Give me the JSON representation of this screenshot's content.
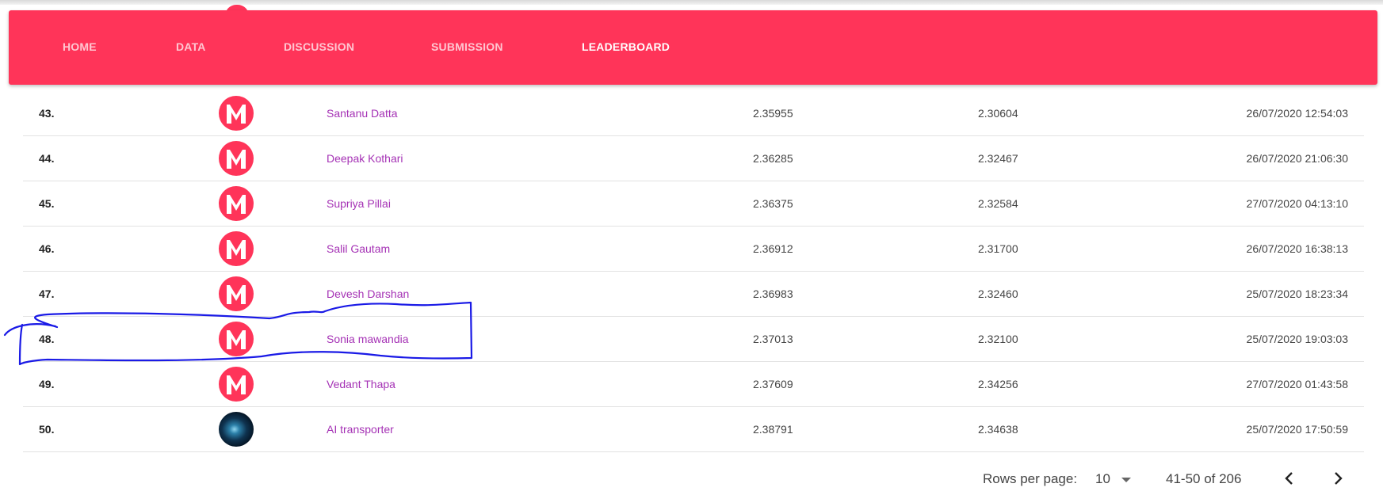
{
  "nav": {
    "items": [
      {
        "label": "HOME",
        "active": false
      },
      {
        "label": "DATA",
        "active": false
      },
      {
        "label": "DISCUSSION",
        "active": false
      },
      {
        "label": "SUBMISSION",
        "active": false
      },
      {
        "label": "LEADERBOARD",
        "active": true
      }
    ],
    "color": "#ff3459"
  },
  "leaderboard": {
    "rows": [
      {
        "rank": "43.",
        "avatar": "m-logo-icon",
        "name": "Santanu Datta",
        "public_score": "2.35955",
        "private_score": "2.30604",
        "timestamp": "26/07/2020 12:54:03"
      },
      {
        "rank": "44.",
        "avatar": "m-logo-icon",
        "name": "Deepak Kothari",
        "public_score": "2.36285",
        "private_score": "2.32467",
        "timestamp": "26/07/2020 21:06:30"
      },
      {
        "rank": "45.",
        "avatar": "m-logo-icon",
        "name": "Supriya Pillai",
        "public_score": "2.36375",
        "private_score": "2.32584",
        "timestamp": "27/07/2020 04:13:10"
      },
      {
        "rank": "46.",
        "avatar": "m-logo-icon",
        "name": "Salil Gautam",
        "public_score": "2.36912",
        "private_score": "2.31700",
        "timestamp": "26/07/2020 16:38:13"
      },
      {
        "rank": "47.",
        "avatar": "m-logo-icon",
        "name": "Devesh Darshan",
        "public_score": "2.36983",
        "private_score": "2.32460",
        "timestamp": "25/07/2020 18:23:34"
      },
      {
        "rank": "48.",
        "avatar": "m-logo-icon",
        "name": "Sonia mawandia",
        "public_score": "2.37013",
        "private_score": "2.32100",
        "timestamp": "25/07/2020 19:03:03"
      },
      {
        "rank": "49.",
        "avatar": "m-logo-icon",
        "name": "Vedant Thapa",
        "public_score": "2.37609",
        "private_score": "2.34256",
        "timestamp": "27/07/2020 01:43:58"
      },
      {
        "rank": "50.",
        "avatar": "photo-avatar",
        "name": "AI transporter",
        "public_score": "2.38791",
        "private_score": "2.34638",
        "timestamp": "25/07/2020 17:50:59"
      }
    ],
    "name_color": "#a532b5"
  },
  "pagination": {
    "rows_per_page_label": "Rows per page:",
    "rows_per_page_value": "10",
    "range_label": "41-50 of 206"
  },
  "annotation": {
    "highlighted_rank": "48.",
    "color": "#1a1ae6"
  }
}
